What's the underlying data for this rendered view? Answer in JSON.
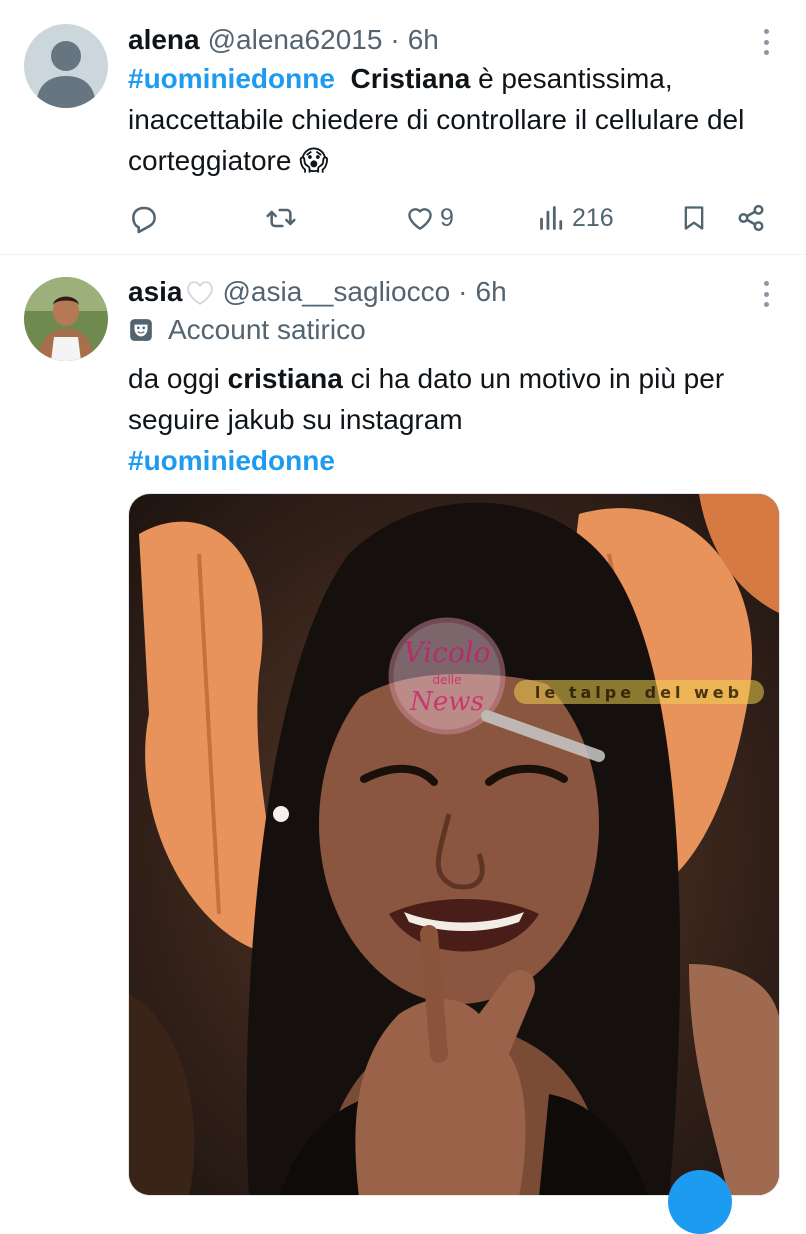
{
  "colors": {
    "accent": "#1d9bf0",
    "secondary_text": "#536471",
    "primary_text": "#0f1419"
  },
  "tweets": [
    {
      "name": "alena",
      "handle": "@alena62015",
      "separator": "·",
      "time": "6h",
      "text": {
        "hashtag": "#uominiedonne",
        "bold_name": "Cristiana",
        "part1": " è  pesantissima, inaccettabile chiedere di controllare il cellulare del corteggiatore ",
        "emoji": "😱"
      },
      "actions": {
        "reply_icon": "reply-icon",
        "retweet_icon": "retweet-icon",
        "like_icon": "heart-icon",
        "likes": "9",
        "views_icon": "views-icon",
        "views": "216",
        "bookmark_icon": "bookmark-icon",
        "share_icon": "share-icon"
      }
    },
    {
      "name": "asia",
      "name_emoji": "🤍",
      "handle": "@asia__sagliocco",
      "separator": "·",
      "time": "6h",
      "label": "Account satirico",
      "text": {
        "part1": "da oggi ",
        "bold_name": "cristiana",
        "part2": " ci ha dato un motivo in più per seguire jakub su instagram",
        "hashtag": "#uominiedonne"
      },
      "media": {
        "watermark1": "Vicolo delle News",
        "watermark2": "le talpe del web"
      }
    }
  ]
}
